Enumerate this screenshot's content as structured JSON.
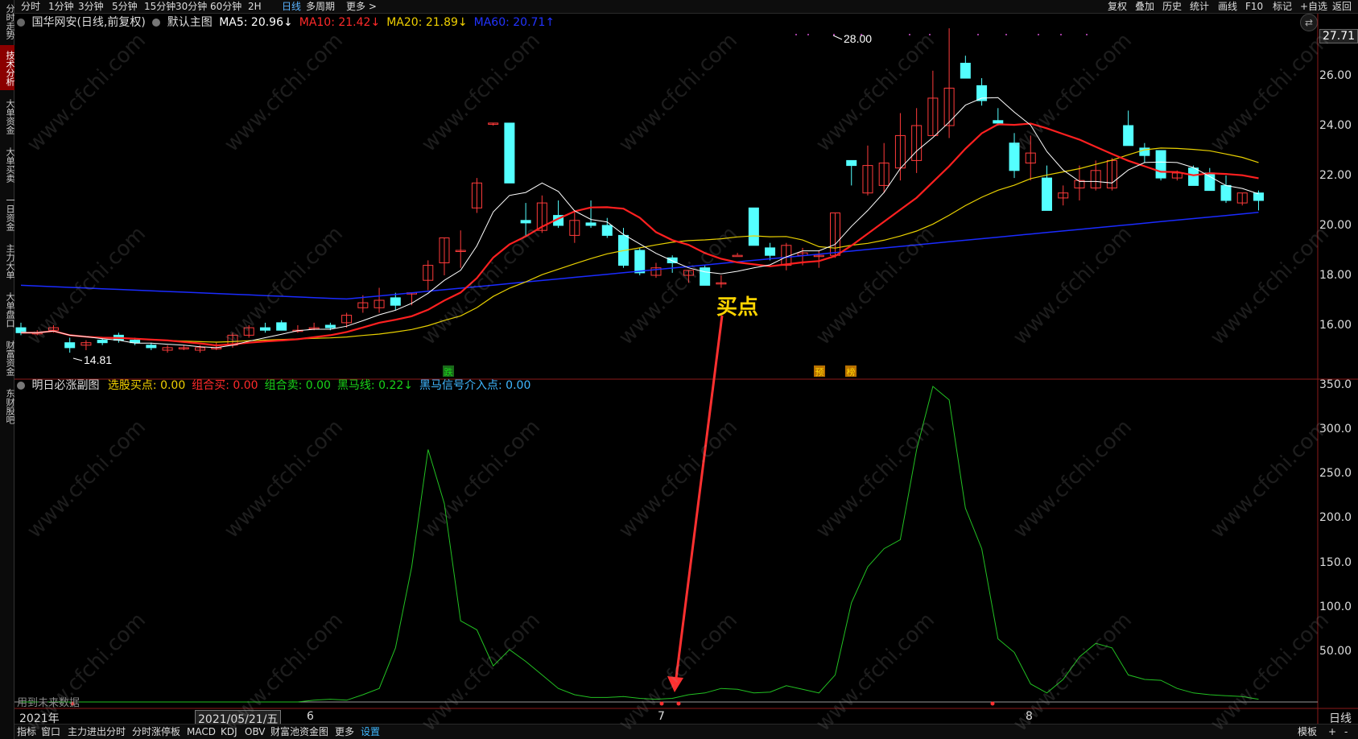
{
  "left_tabs": [
    "分时走势",
    "技术分析",
    "大单资金",
    "大单买卖",
    "一日资金",
    "主力大单",
    "大单盘口",
    "财富资金",
    "东财股吧"
  ],
  "left_active": "技术分析",
  "top_tabs": [
    "分时",
    "1分钟",
    "3分钟",
    "5分钟",
    "15分钟",
    "30分钟",
    "60分钟",
    "2H",
    "日线",
    "多周期",
    "更多 >"
  ],
  "top_active": "日线",
  "top_right": [
    "复权",
    "叠加",
    "历史",
    "统计",
    "画线",
    "F10",
    "标记",
    "+自选",
    "返回"
  ],
  "stock": {
    "name": "国华网安(日线,前复权)",
    "main_chart": "默认主图"
  },
  "ma": [
    {
      "label": "MA5: 20.96↓",
      "color": "#ffffff"
    },
    {
      "label": "MA10: 21.42↓",
      "color": "#ff2a2a"
    },
    {
      "label": "MA20: 21.89↓",
      "color": "#f0d000"
    },
    {
      "label": "MA60: 20.71↑",
      "color": "#2233ff"
    }
  ],
  "price_axis": {
    "top_label": "27.71",
    "ticks": [
      "26.00",
      "24.00",
      "22.00",
      "20.00",
      "18.00",
      "16.00"
    ]
  },
  "annotations": {
    "high": "28.00",
    "low": "14.81",
    "buy": "买点",
    "tag_die": "跌",
    "tag_yu": "预",
    "tag_bang": "榜"
  },
  "sub": {
    "title": "明日必涨副图",
    "items": [
      {
        "label": "选股买点: 0.00",
        "color": "#f0d000"
      },
      {
        "label": "组合买: 0.00",
        "color": "#ff2a2a"
      },
      {
        "label": "组合卖: 0.00",
        "color": "#19d219"
      },
      {
        "label": "黑马线: 0.22↓",
        "color": "#19d219"
      },
      {
        "label": "黑马信号介入点: 0.00",
        "color": "#3fb7ff"
      }
    ],
    "axis": [
      "350.0",
      "300.0",
      "250.0",
      "200.0",
      "150.0",
      "100.0",
      "50.00"
    ],
    "hint": "用到未来数据"
  },
  "dates": {
    "start": "2021年",
    "hover": "2021/05/21/五",
    "m6": "6",
    "m7": "7",
    "m8": "8",
    "period": "日线"
  },
  "bottom_tabs": [
    "指标",
    "窗口",
    "主力进出分时",
    "分时涨停板",
    "MACD",
    "KDJ",
    "OBV",
    "财富池资金图",
    "更多",
    "设置"
  ],
  "bottom_active": "设置",
  "bottom_right": [
    "模板",
    "+",
    "-"
  ],
  "watermark": "www.cfchi.com",
  "colors": {
    "up": "#ff3b3b",
    "down": "#54ffff",
    "ma5": "#ffffff",
    "ma10": "#ff2020",
    "ma20": "#e8d000",
    "ma60": "#1a2bff",
    "vol": "#22c022"
  }
}
